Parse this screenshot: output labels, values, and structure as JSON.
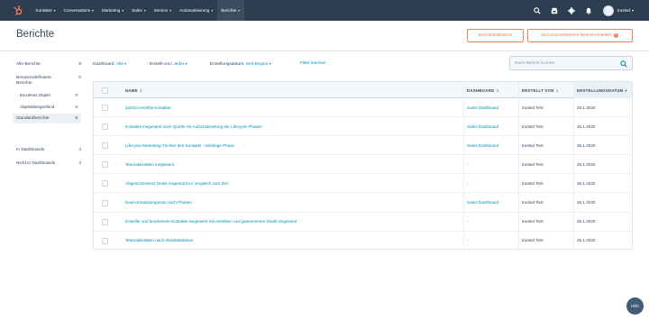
{
  "nav": {
    "items": [
      {
        "label": "Kontakte",
        "chevron": true
      },
      {
        "label": "Conversations",
        "chevron": true
      },
      {
        "label": "Marketing",
        "chevron": true
      },
      {
        "label": "Sales",
        "chevron": true
      },
      {
        "label": "Service",
        "chevron": true
      },
      {
        "label": "Automatisierung",
        "chevron": true
      },
      {
        "label": "Berichte",
        "chevron": true,
        "active": true
      }
    ],
    "account_name": "trusted",
    "colors": {
      "bar": "#2d3e50",
      "logo": "#ff7a59"
    }
  },
  "header": {
    "title": "Berichte",
    "library_button": "Berichtsbibliothek",
    "custom_button": "Benutzerdefinierten Bericht erstellen",
    "custom_button_badge": "!"
  },
  "sidebar": {
    "items": [
      {
        "label": "Alle Berichte",
        "count": "8"
      },
      {
        "label": "Benutzerdefinierte Berichte",
        "count": "0"
      },
      {
        "label": "Einzelnes Objekt",
        "count": "0",
        "sub": true
      },
      {
        "label": "Objektübergreifend",
        "count": "0",
        "sub": true
      },
      {
        "label": "Standardberichte",
        "count": "8",
        "active": true
      },
      {
        "label": "In Dashboards",
        "count": "4"
      },
      {
        "label": "Nicht in Dashboards",
        "count": "4"
      }
    ]
  },
  "filters": {
    "dashboard_label": "Dashboard:",
    "dashboard_value": "Alle",
    "created_by_label": "Erstellt von:",
    "created_by_value": "Jeder",
    "created_date_label": "Erstellungsdatum:",
    "created_date_value": "Seit Beginn",
    "clear_link": "Filter löschen"
  },
  "search": {
    "placeholder": "Nach Bericht suchen"
  },
  "table": {
    "columns": {
      "name": "NAME",
      "dashboard": "DASHBOARD",
      "created_by": "ERSTELLT VON",
      "created_date": "ERSTELLUNGSDATUM"
    },
    "rows": [
      {
        "name": "Zuletzt erstellte Kontakte",
        "dashboard": "Sales Dashboard",
        "created_by": "trusted Test",
        "date": "26.1.2020"
      },
      {
        "name": "Kontakte insgesamt nach Quelle mit Aufschlüsselung der Lifecycle Phasen",
        "dashboard": "Sales Dashboard",
        "created_by": "trusted Test",
        "date": "26.1.2020"
      },
      {
        "name": "Lifecycle-Marketing-Trichter des Kontakts - beliebige Phase",
        "dashboard": "Sales Dashboard",
        "created_by": "trusted Test",
        "date": "26.1.2020"
      },
      {
        "name": "Teamaktivitäten insgesamt",
        "dashboard": "--",
        "created_by": "trusted Test",
        "date": "26.1.2020"
      },
      {
        "name": "Abgeschlossene Deals insgesamt im Vergleich zum Ziel",
        "dashboard": "--",
        "created_by": "trusted Test",
        "date": "26.1.2020"
      },
      {
        "name": "Deal-Umsatzprognose nach Phasen",
        "dashboard": "Sales Dashboard",
        "created_by": "trusted Test",
        "date": "26.1.2020"
      },
      {
        "name": "Erstellte und bearbeitete Kontakte insgesamt mit erstellten und gewonnenen Deals insgesamt",
        "dashboard": "--",
        "created_by": "trusted Test",
        "date": "26.1.2020"
      },
      {
        "name": "Teamaktivitäten nach Aktivitätsdatum",
        "dashboard": "--",
        "created_by": "trusted Test",
        "date": "26.1.2020"
      }
    ]
  },
  "help_button": "Hilfe"
}
